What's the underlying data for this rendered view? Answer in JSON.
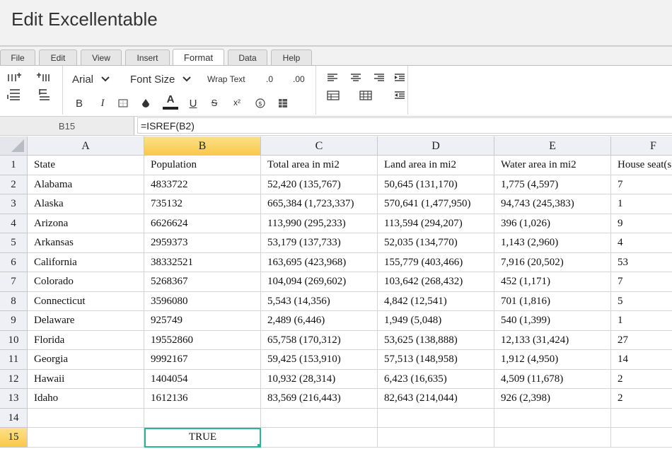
{
  "app": {
    "title": "Edit Excellentable"
  },
  "menu": {
    "tabs": [
      {
        "label": "File"
      },
      {
        "label": "Edit"
      },
      {
        "label": "View"
      },
      {
        "label": "Insert"
      },
      {
        "label": "Format",
        "active": true
      },
      {
        "label": "Data"
      },
      {
        "label": "Help"
      }
    ]
  },
  "toolbar": {
    "font_name": "Arial",
    "font_size": "Font Size",
    "wrap_text": "Wrap Text",
    "decimal_less": ".0",
    "decimal_more": ".00",
    "bold": "B",
    "italic": "I",
    "font_color": "A",
    "underline": "U",
    "strikethrough": "S",
    "superscript": "x²",
    "icons": [
      "insert-row-above-icon",
      "insert-column-left-icon",
      "insert-row-below-icon",
      "delete-row-icon",
      "border-icon",
      "fill-color-icon",
      "currency-icon",
      "conditional-format-icon",
      "align-left-icon",
      "align-center-icon",
      "align-right-icon",
      "indent-icon",
      "table-icon",
      "merge-cells-icon",
      "outdent-icon"
    ]
  },
  "formula_bar": {
    "cell_ref": "B15",
    "formula": "=ISREF(B2)"
  },
  "sheet": {
    "columns": [
      "A",
      "B",
      "C",
      "D",
      "E",
      "F"
    ],
    "selected_cell": "B15",
    "rows": [
      {
        "n": "1",
        "cells": [
          "State",
          "Population",
          "Total area in mi2",
          "Land area in mi2",
          "Water area in mi2",
          "House seat(s)"
        ]
      },
      {
        "n": "2",
        "cells": [
          "Alabama",
          "4833722",
          "52,420 (135,767)",
          "50,645 (131,170)",
          "1,775 (4,597)",
          "7"
        ]
      },
      {
        "n": "3",
        "cells": [
          "Alaska",
          "735132",
          "665,384 (1,723,337)",
          "570,641 (1,477,950)",
          "94,743 (245,383)",
          "1"
        ]
      },
      {
        "n": "4",
        "cells": [
          "Arizona",
          "6626624",
          "113,990 (295,233)",
          "113,594 (294,207)",
          "396 (1,026)",
          "9"
        ]
      },
      {
        "n": "5",
        "cells": [
          "Arkansas",
          "2959373",
          "53,179 (137,733)",
          "52,035 (134,770)",
          "1,143 (2,960)",
          "4"
        ]
      },
      {
        "n": "6",
        "cells": [
          "California",
          "38332521",
          "163,695 (423,968)",
          "155,779 (403,466)",
          "7,916 (20,502)",
          "53"
        ]
      },
      {
        "n": "7",
        "cells": [
          "Colorado",
          "5268367",
          "104,094 (269,602)",
          "103,642 (268,432)",
          "452 (1,171)",
          "7"
        ]
      },
      {
        "n": "8",
        "cells": [
          "Connecticut",
          "3596080",
          "5,543 (14,356)",
          "4,842 (12,541)",
          "701 (1,816)",
          "5"
        ]
      },
      {
        "n": "9",
        "cells": [
          "Delaware",
          "925749",
          "2,489 (6,446)",
          "1,949 (5,048)",
          "540 (1,399)",
          "1"
        ]
      },
      {
        "n": "10",
        "cells": [
          "Florida",
          "19552860",
          "65,758 (170,312)",
          "53,625 (138,888)",
          "12,133 (31,424)",
          "27"
        ]
      },
      {
        "n": "11",
        "cells": [
          "Georgia",
          "9992167",
          "59,425 (153,910)",
          "57,513 (148,958)",
          "1,912 (4,950)",
          "14"
        ]
      },
      {
        "n": "12",
        "cells": [
          "Hawaii",
          "1404054",
          "10,932 (28,314)",
          "6,423 (16,635)",
          "4,509 (11,678)",
          "2"
        ]
      },
      {
        "n": "13",
        "cells": [
          "Idaho",
          "1612136",
          "83,569 (216,443)",
          "82,643 (214,044)",
          "926 (2,398)",
          "2"
        ]
      },
      {
        "n": "14",
        "cells": [
          "",
          "",
          "",
          "",
          "",
          ""
        ]
      },
      {
        "n": "15",
        "cells": [
          "",
          "TRUE",
          "",
          "",
          "",
          ""
        ]
      }
    ]
  },
  "colors": {
    "accent_selection": "#2bb39a",
    "header_selected": "#f8c94a"
  }
}
